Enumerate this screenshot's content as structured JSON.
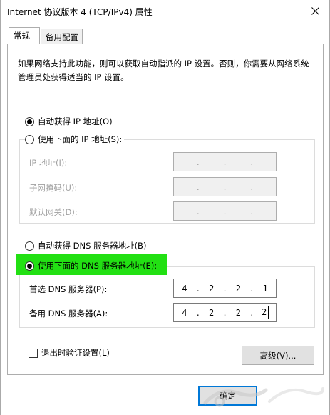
{
  "window": {
    "title": "Internet 协议版本 4 (TCP/IPv4) 属性",
    "close_icon": "close-icon"
  },
  "tabs": [
    {
      "label": "常规",
      "active": true
    },
    {
      "label": "备用配置",
      "active": false
    }
  ],
  "description": "如果网络支持此功能，则可以获取自动指派的 IP 设置。否则，你需要从网络系统管理员处获得适当的 IP 设置。",
  "ip_mode": {
    "auto_label": "自动获得 IP 地址(O)",
    "manual_label": "使用下面的 IP 地址(S):",
    "selected": "auto"
  },
  "ip_fields": [
    {
      "label": "IP 地址(I):",
      "value": [
        "",
        "",
        "",
        ""
      ],
      "enabled": false
    },
    {
      "label": "子网掩码(U):",
      "value": [
        "",
        "",
        "",
        ""
      ],
      "enabled": false
    },
    {
      "label": "默认网关(D):",
      "value": [
        "",
        "",
        "",
        ""
      ],
      "enabled": false
    }
  ],
  "dns_mode": {
    "auto_label": "自动获得 DNS 服务器地址(B)",
    "manual_label": "使用下面的 DNS 服务器地址(E):",
    "selected": "manual",
    "highlight_color": "#22e013"
  },
  "dns_fields": [
    {
      "label": "首选 DNS 服务器(P):",
      "value": [
        "4",
        "2",
        "2",
        "1"
      ],
      "enabled": true
    },
    {
      "label": "备用 DNS 服务器(A):",
      "value": [
        "4",
        "2",
        "2",
        "2"
      ],
      "enabled": true
    }
  ],
  "validate_checkbox": {
    "label": "退出时验证设置(L)",
    "checked": false
  },
  "buttons": {
    "advanced": "高级(V)...",
    "ok": "确定",
    "accent": "#0078d7"
  }
}
